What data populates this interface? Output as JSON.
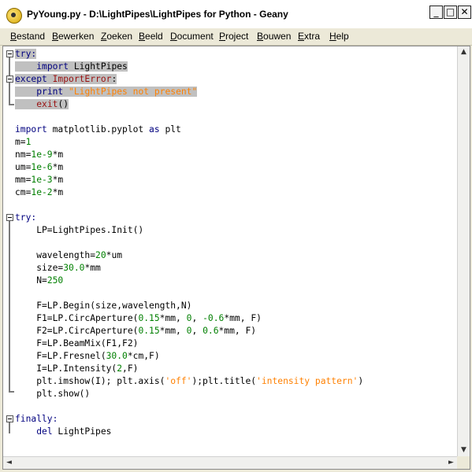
{
  "window": {
    "title": "PyYoung.py - D:\\LightPipes\\LightPipes for Python - Geany",
    "minimize": "_",
    "maximize": "□",
    "close": "✕"
  },
  "menu": {
    "items": [
      {
        "u": "B",
        "rest": "estand"
      },
      {
        "u": "B",
        "rest": "ewerken"
      },
      {
        "u": "Z",
        "rest": "oeken"
      },
      {
        "u": "B",
        "rest": "eeld"
      },
      {
        "u": "D",
        "rest": "ocument"
      },
      {
        "u": "P",
        "rest": "roject"
      },
      {
        "u": "B",
        "rest": "ouwen"
      },
      {
        "u": "E",
        "rest": "xtra"
      },
      {
        "u": "H",
        "rest": "elp"
      }
    ]
  },
  "scroll": {
    "up": "▲",
    "down": "▼",
    "left": "◄",
    "right": "►"
  },
  "code_lines": [
    [
      {
        "t": "try:",
        "c": "kw"
      }
    ],
    [
      {
        "t": "    "
      },
      {
        "t": "import",
        "c": "kw"
      },
      {
        "t": " LightPipes"
      }
    ],
    [
      {
        "t": "except",
        "c": "kw"
      },
      {
        "t": " "
      },
      {
        "t": "ImportError",
        "c": "exc"
      },
      {
        "t": ":"
      }
    ],
    [
      {
        "t": "    "
      },
      {
        "t": "print",
        "c": "kw"
      },
      {
        "t": " "
      },
      {
        "t": "\"LightPipes not present\"",
        "c": "str"
      }
    ],
    [
      {
        "t": "    "
      },
      {
        "t": "exit",
        "c": "exc"
      },
      {
        "t": "()"
      }
    ],
    [],
    [
      {
        "t": "import",
        "c": "kw"
      },
      {
        "t": " matplotlib.pyplot "
      },
      {
        "t": "as",
        "c": "kw"
      },
      {
        "t": " plt"
      }
    ],
    [
      {
        "t": "m="
      },
      {
        "t": "1",
        "c": "num"
      }
    ],
    [
      {
        "t": "nm="
      },
      {
        "t": "1e-9",
        "c": "num"
      },
      {
        "t": "*m"
      }
    ],
    [
      {
        "t": "um="
      },
      {
        "t": "1e-6",
        "c": "num"
      },
      {
        "t": "*m"
      }
    ],
    [
      {
        "t": "mm="
      },
      {
        "t": "1e-3",
        "c": "num"
      },
      {
        "t": "*m"
      }
    ],
    [
      {
        "t": "cm="
      },
      {
        "t": "1e-2",
        "c": "num"
      },
      {
        "t": "*m"
      }
    ],
    [],
    [
      {
        "t": "try:",
        "c": "kw"
      }
    ],
    [
      {
        "t": "    LP=LightPipes.Init()"
      }
    ],
    [],
    [
      {
        "t": "    wavelength="
      },
      {
        "t": "20",
        "c": "num"
      },
      {
        "t": "*um"
      }
    ],
    [
      {
        "t": "    size="
      },
      {
        "t": "30.0",
        "c": "num"
      },
      {
        "t": "*mm"
      }
    ],
    [
      {
        "t": "    N="
      },
      {
        "t": "250",
        "c": "num"
      }
    ],
    [],
    [
      {
        "t": "    F=LP.Begin(size,wavelength,N)"
      }
    ],
    [
      {
        "t": "    F1=LP.CircAperture("
      },
      {
        "t": "0.15",
        "c": "num"
      },
      {
        "t": "*mm, "
      },
      {
        "t": "0",
        "c": "num"
      },
      {
        "t": ", "
      },
      {
        "t": "-0.6",
        "c": "num"
      },
      {
        "t": "*mm, F)"
      }
    ],
    [
      {
        "t": "    F2=LP.CircAperture("
      },
      {
        "t": "0.15",
        "c": "num"
      },
      {
        "t": "*mm, "
      },
      {
        "t": "0",
        "c": "num"
      },
      {
        "t": ", "
      },
      {
        "t": "0.6",
        "c": "num"
      },
      {
        "t": "*mm, F)"
      }
    ],
    [
      {
        "t": "    F=LP.BeamMix(F1,F2)"
      }
    ],
    [
      {
        "t": "    F=LP.Fresnel("
      },
      {
        "t": "30.0",
        "c": "num"
      },
      {
        "t": "*cm,F)"
      }
    ],
    [
      {
        "t": "    I=LP.Intensity("
      },
      {
        "t": "2",
        "c": "num"
      },
      {
        "t": ",F)"
      }
    ],
    [
      {
        "t": "    plt.imshow(I); plt.axis("
      },
      {
        "t": "'off'",
        "c": "str"
      },
      {
        "t": ");plt.title("
      },
      {
        "t": "'intensity pattern'",
        "c": "str"
      },
      {
        "t": ")"
      }
    ],
    [
      {
        "t": "    plt.show()"
      }
    ],
    [],
    [
      {
        "t": "finally:",
        "c": "kw"
      }
    ],
    [
      {
        "t": "    "
      },
      {
        "t": "del",
        "c": "kw"
      },
      {
        "t": " LightPipes"
      }
    ]
  ]
}
